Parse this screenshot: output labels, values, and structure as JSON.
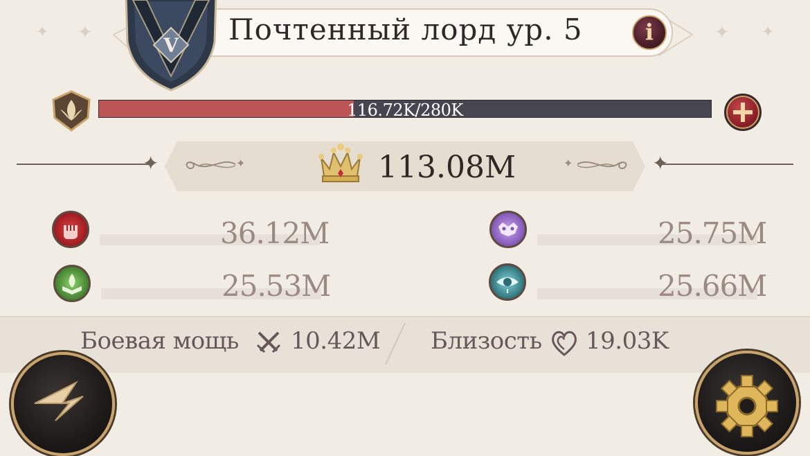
{
  "header": {
    "title": "Почтенный лорд ур. 5",
    "info_label": "i",
    "emblem_letter": "V"
  },
  "experience": {
    "text": "116.72K/280K",
    "progress": 0.4168
  },
  "power": {
    "value": "113.08M"
  },
  "stats": [
    {
      "icon": "fist-icon",
      "value": "36.12M",
      "color": "#b02830"
    },
    {
      "icon": "mask-icon",
      "value": "25.75M",
      "color": "#8a5fb8"
    },
    {
      "icon": "book-leaf-icon",
      "value": "25.53M",
      "color": "#4e8a3c"
    },
    {
      "icon": "eye-icon",
      "value": "25.66M",
      "color": "#2e7a82"
    }
  ],
  "footer": {
    "combat_label": "Боевая мощь",
    "combat_value": "10.42M",
    "intimacy_label": "Близость",
    "intimacy_value": "19.03K"
  },
  "colors": {
    "background": "#f1ece4",
    "exp_fill": "#bb5556",
    "exp_track": "#474650",
    "gold": "#c9a46a"
  }
}
